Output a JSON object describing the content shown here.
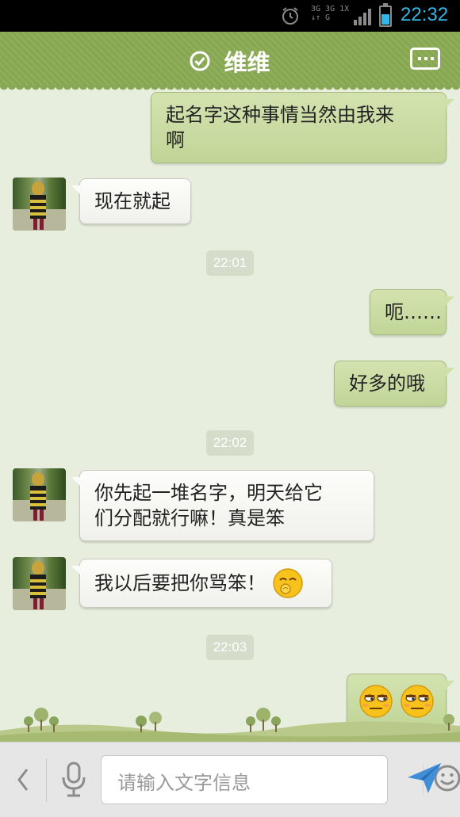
{
  "status_bar": {
    "network_label_top": "3G 3G 1X",
    "network_label_bottom": "↓↑ G",
    "time": "22:32",
    "battery_level": 0.55,
    "accent_color": "#33b5e5"
  },
  "header": {
    "title": "维维",
    "verified_icon": "check-circle-icon",
    "menu_icon": "more-dots-icon",
    "background_color": "#8aa957"
  },
  "messages": [
    {
      "side": "right",
      "text_lines": [
        "起名字这种事情当然由我来",
        "啊"
      ]
    },
    {
      "side": "left",
      "text": "现在就起"
    },
    {
      "type": "time",
      "text": "22:01"
    },
    {
      "side": "right",
      "text": "呃……"
    },
    {
      "side": "right",
      "text": "好多的哦"
    },
    {
      "type": "time",
      "text": "22:02"
    },
    {
      "side": "left",
      "text_lines": [
        "你先起一堆名字，明天给它",
        "们分配就行嘛！真是笨"
      ]
    },
    {
      "side": "left",
      "text": "我以后要把你骂笨！",
      "emoji": "giggle-emoji"
    },
    {
      "type": "time",
      "text": "22:03"
    },
    {
      "side": "right",
      "emojis": [
        "smug-emoji",
        "smug-emoji"
      ]
    }
  ],
  "input": {
    "placeholder": "请输入文字信息",
    "back_icon": "chevron-left-icon",
    "mic_icon": "microphone-icon",
    "emoji_icon": "smiley-icon",
    "send_icon": "send-icon"
  }
}
